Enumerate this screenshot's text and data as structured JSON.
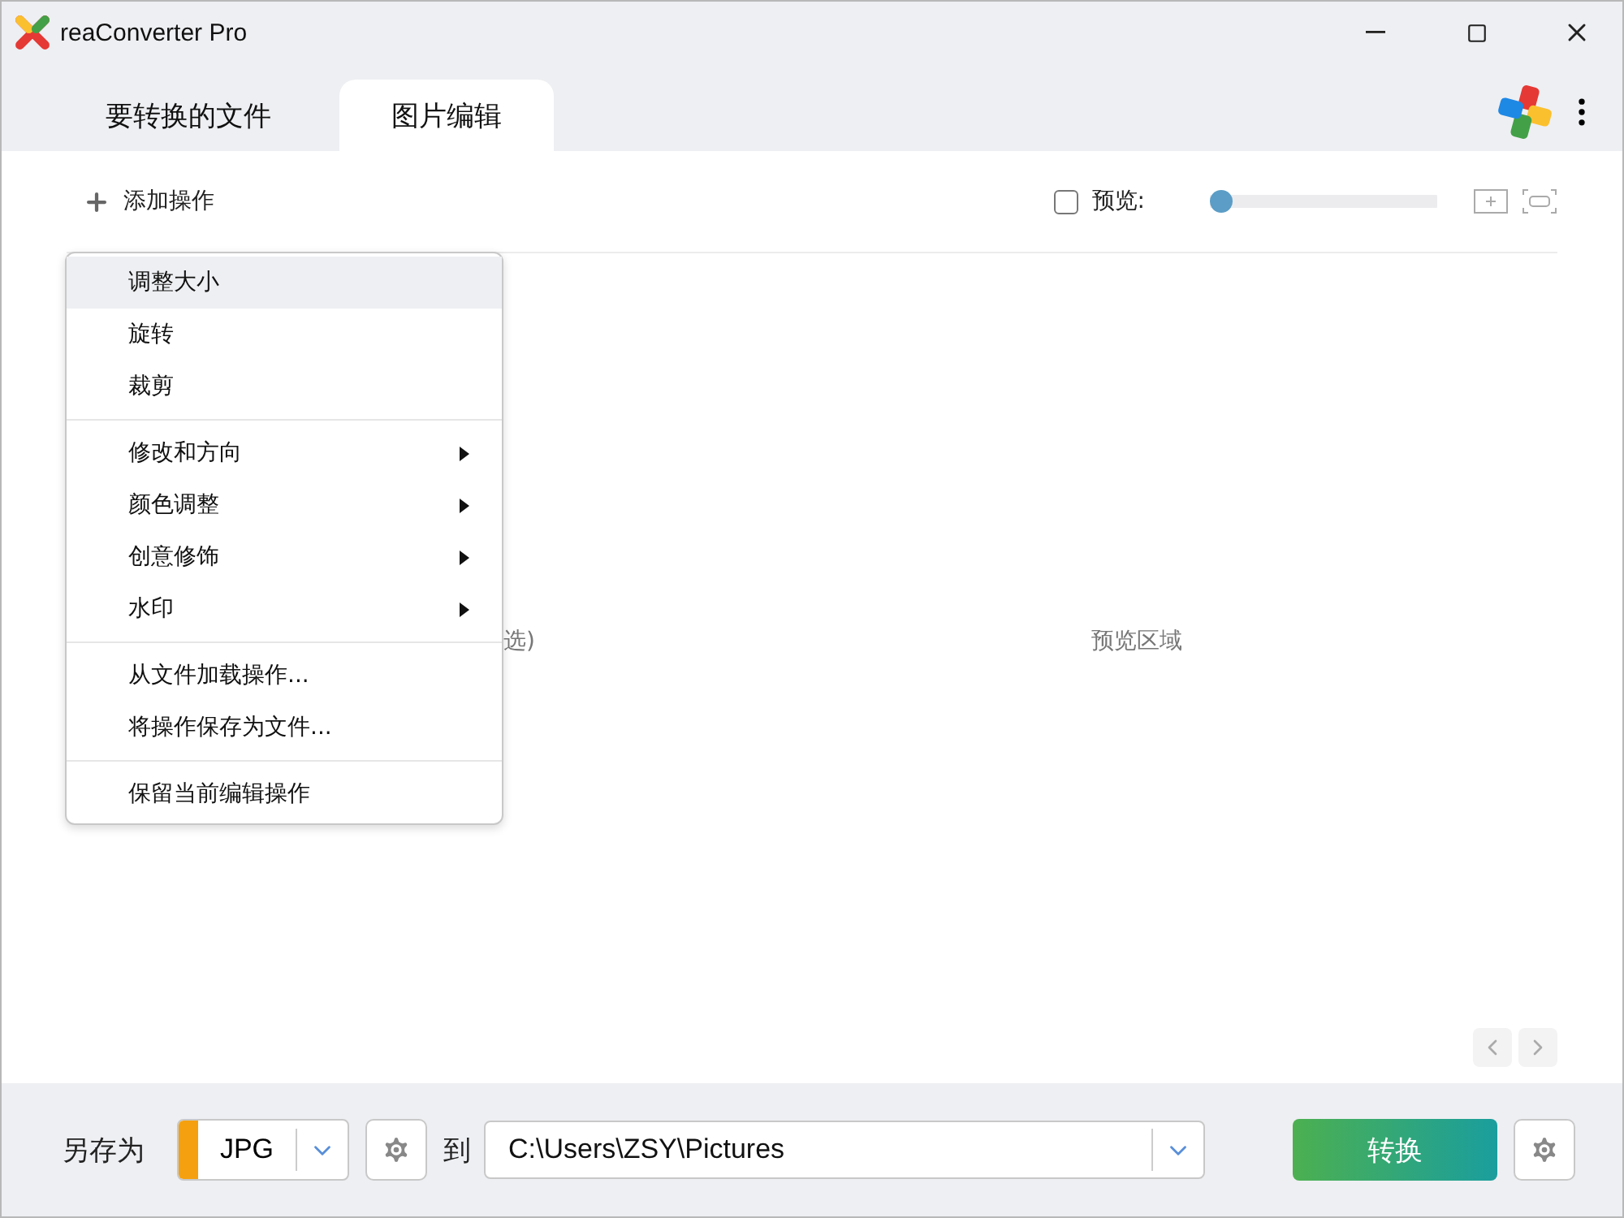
{
  "window": {
    "title": "reaConverter Pro"
  },
  "tabs": [
    {
      "label": "要转换的文件",
      "selected": false
    },
    {
      "label": "图片编辑",
      "selected": true
    }
  ],
  "toolbar": {
    "add_label": "添加操作",
    "preview": {
      "label": "预览:",
      "checked": false
    },
    "zoom": {
      "level": 0
    }
  },
  "menu": {
    "groups": [
      [
        {
          "label": "调整大小",
          "selected": true,
          "submenu": false
        },
        {
          "label": "旋转",
          "selected": false,
          "submenu": false
        },
        {
          "label": "裁剪",
          "selected": false,
          "submenu": false
        }
      ],
      [
        {
          "label": "修改和方向",
          "selected": false,
          "submenu": true
        },
        {
          "label": "颜色调整",
          "selected": false,
          "submenu": true
        },
        {
          "label": "创意修饰",
          "selected": false,
          "submenu": true
        },
        {
          "label": "水印",
          "selected": false,
          "submenu": true
        }
      ],
      [
        {
          "label": "从文件加载操作...",
          "selected": false,
          "submenu": false
        },
        {
          "label": "将操作保存为文件...",
          "selected": false,
          "submenu": false
        }
      ],
      [
        {
          "label": "保留当前编辑操作",
          "selected": false,
          "submenu": false
        }
      ]
    ]
  },
  "operations_hint": "选)",
  "preview_hint": "预览区域",
  "bottom": {
    "save_as_label": "另存为",
    "format": {
      "value": "JPG",
      "color": "#f5a00f"
    },
    "to_label": "到",
    "path": "C:\\Users\\ZSY\\Pictures",
    "convert": "转换"
  }
}
